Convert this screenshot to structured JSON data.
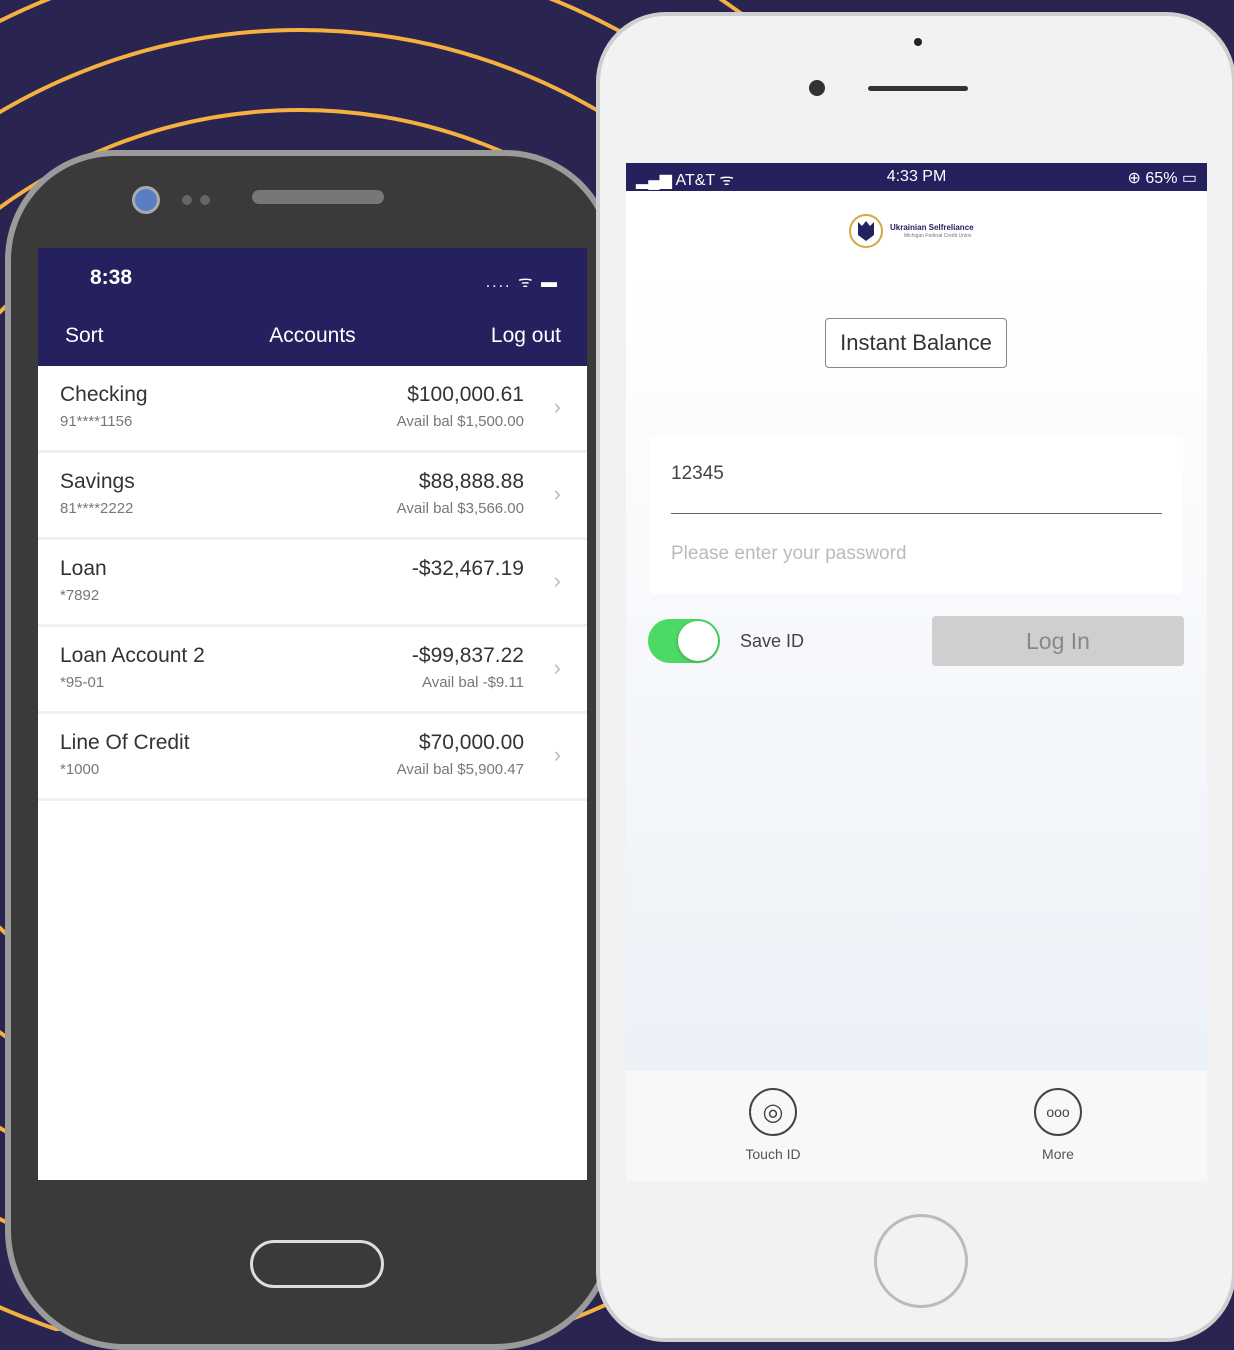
{
  "colors": {
    "brand": "#25215f",
    "accent": "#f5b041",
    "toggle": "#4cd964"
  },
  "android": {
    "time": "8:38",
    "status": ".... ᯤ ▬",
    "nav": {
      "sort": "Sort",
      "title": "Accounts",
      "logout": "Log out"
    },
    "accounts": [
      {
        "name": "Checking",
        "number": "91****1156",
        "balance": "$100,000.61",
        "avail": "Avail bal $1,500.00"
      },
      {
        "name": "Savings",
        "number": "81****2222",
        "balance": "$88,888.88",
        "avail": "Avail bal $3,566.00"
      },
      {
        "name": "Loan",
        "number": "*7892",
        "balance": "-$32,467.19",
        "avail": ""
      },
      {
        "name": "Loan Account 2",
        "number": "*95-01",
        "balance": "-$99,837.22",
        "avail": "Avail bal -$9.11"
      },
      {
        "name": "Line Of Credit",
        "number": "*1000",
        "balance": "$70,000.00",
        "avail": "Avail bal $5,900.47"
      }
    ]
  },
  "iphone": {
    "carrier": "AT&T",
    "time": "4:33 PM",
    "battery": "65%",
    "logo": {
      "name": "Ukrainian Selfreliance",
      "sub": "Michigan Federal Credit Union"
    },
    "instant_balance": "Instant Balance",
    "user_id_value": "12345",
    "password_placeholder": "Please enter your password",
    "save_id": "Save ID",
    "save_id_on": true,
    "login": "Log In",
    "footer": {
      "touch_id": "Touch ID",
      "more": "More"
    }
  }
}
